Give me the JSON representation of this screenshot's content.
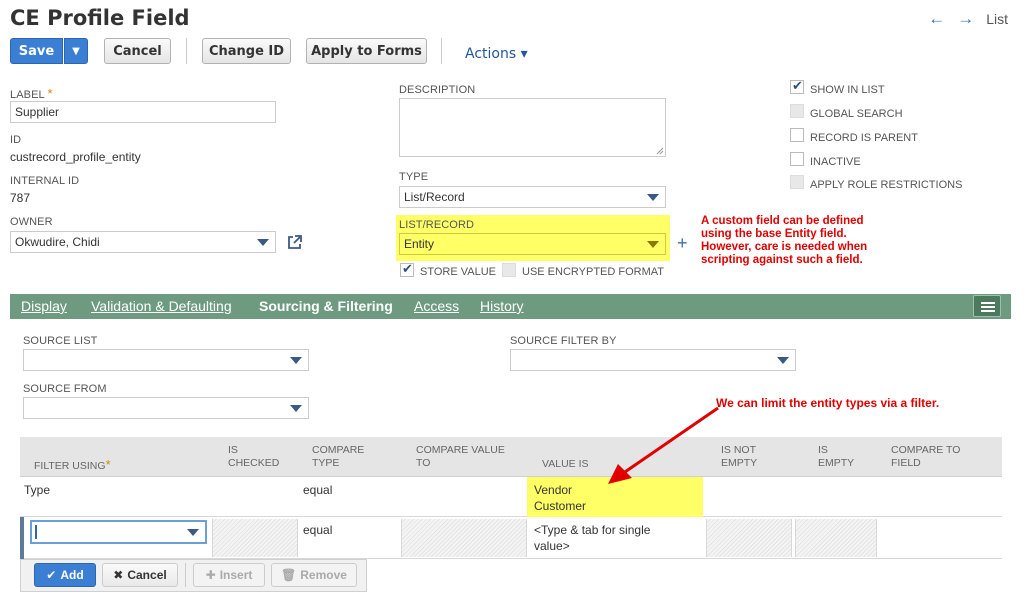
{
  "page": {
    "title": "CE Profile Field",
    "list_link": "List",
    "back_arrow": "←",
    "forward_arrow": "→"
  },
  "toolbar": {
    "save_label": "Save",
    "save_dropdown": "▼",
    "cancel_label": "Cancel",
    "change_id_label": "Change ID",
    "apply_to_forms_label": "Apply to Forms",
    "actions_label": "Actions ▾"
  },
  "fields": {
    "label": {
      "label": "LABEL",
      "required_mark": "*",
      "value": "Supplier"
    },
    "id": {
      "label": "ID",
      "value": "custrecord_profile_entity"
    },
    "internal_id": {
      "label": "INTERNAL ID",
      "value": "787"
    },
    "owner": {
      "label": "OWNER",
      "value": "Okwudire, Chidi"
    },
    "description": {
      "label": "DESCRIPTION",
      "value": ""
    },
    "type": {
      "label": "TYPE",
      "value": "List/Record"
    },
    "list_record": {
      "label": "LIST/RECORD",
      "value": "Entity",
      "add": "+"
    },
    "store_value": {
      "label": "STORE VALUE",
      "checked": true
    },
    "use_encrypted_format": {
      "label": "USE ENCRYPTED FORMAT",
      "checked": false
    }
  },
  "checkboxes": [
    {
      "label": "SHOW IN LIST",
      "checked": true,
      "disabled": false
    },
    {
      "label": "GLOBAL SEARCH",
      "checked": false,
      "disabled": true
    },
    {
      "label": "RECORD IS PARENT",
      "checked": false,
      "disabled": false
    },
    {
      "label": "INACTIVE",
      "checked": false,
      "disabled": false
    },
    {
      "label": "APPLY ROLE RESTRICTIONS",
      "checked": false,
      "disabled": true
    }
  ],
  "annotations": {
    "note1": [
      "A custom field can be defined",
      "using the base Entity field.",
      "However, care is needed when",
      "scripting against such a field."
    ],
    "note2": "We can limit the entity types via a filter."
  },
  "tabs": [
    {
      "label": "Display",
      "active": false
    },
    {
      "label": "Validation & Defaulting",
      "active": false
    },
    {
      "label": "Sourcing & Filtering",
      "active": true
    },
    {
      "label": "Access",
      "active": false
    },
    {
      "label": "History",
      "active": false
    }
  ],
  "sourcing": {
    "source_list": {
      "label": "SOURCE LIST",
      "value": ""
    },
    "source_from": {
      "label": "SOURCE FROM",
      "value": ""
    },
    "source_filter_by": {
      "label": "SOURCE FILTER BY",
      "value": ""
    }
  },
  "filter_table": {
    "headers": {
      "filter_using": "FILTER USING",
      "is_checked": [
        "IS",
        "CHECKED"
      ],
      "compare_type": [
        "COMPARE",
        "TYPE"
      ],
      "compare_value_to": [
        "COMPARE VALUE",
        "TO"
      ],
      "value_is": "VALUE IS",
      "is_not_empty": [
        "IS NOT",
        "EMPTY"
      ],
      "is_empty": [
        "IS",
        "EMPTY"
      ],
      "compare_to_field": [
        "COMPARE TO",
        "FIELD"
      ]
    },
    "required_mark": "*",
    "rows": [
      {
        "filter_using": "Type",
        "compare_type": "equal",
        "value_is": [
          "Vendor",
          "Customer"
        ]
      },
      {
        "filter_using": "",
        "compare_type": "equal",
        "value_is": [
          "<Type & tab for single",
          "value>"
        ]
      }
    ]
  },
  "row_buttons": {
    "add": "Add",
    "cancel": "Cancel",
    "insert": "Insert",
    "remove": "Remove"
  },
  "colors": {
    "primary_button": "#3b7fd4",
    "tab_bar": "#6e9a80",
    "highlight": "#ffff66",
    "annotation": "#e00000"
  }
}
